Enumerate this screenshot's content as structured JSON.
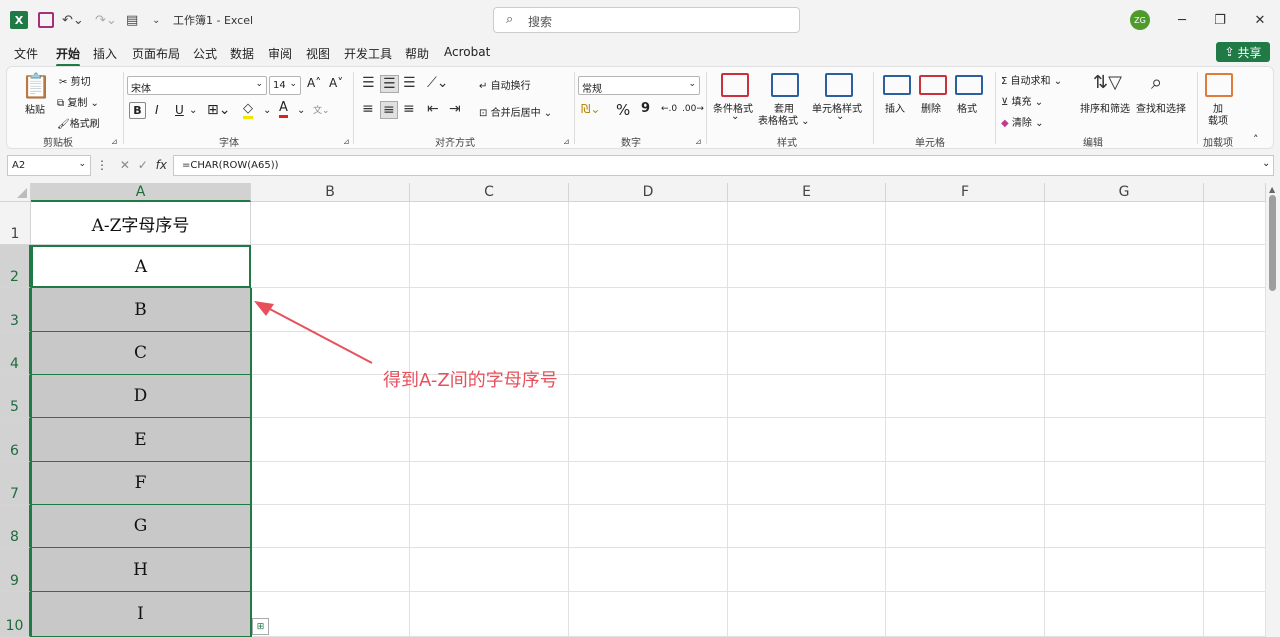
{
  "titlebar": {
    "logo": "X",
    "doc_title": "工作簿1 - Excel",
    "search_placeholder": "搜索",
    "avatar": "ZG",
    "min": "─",
    "restore": "❐",
    "close": "✕"
  },
  "menu": {
    "items": [
      "文件",
      "开始",
      "插入",
      "页面布局",
      "公式",
      "数据",
      "审阅",
      "视图",
      "开发工具",
      "帮助",
      "Acrobat"
    ],
    "active_index": 1,
    "share": "共享"
  },
  "ribbon": {
    "clipboard": {
      "paste": "粘贴",
      "cut": "剪切",
      "copy": "复制",
      "format_painter": "格式刷",
      "label": "剪贴板"
    },
    "font": {
      "font_name": "宋体",
      "font_size": "14",
      "bold": "B",
      "italic": "I",
      "underline": "U",
      "label": "字体"
    },
    "alignment": {
      "wrap": "自动换行",
      "merge": "合并后居中",
      "label": "对齐方式"
    },
    "number": {
      "format": "常规",
      "percent": "%",
      "comma": "9",
      "label": "数字"
    },
    "styles": {
      "conditional": "条件格式",
      "table1": "套用",
      "table2": "表格格式",
      "cell_styles": "单元格样式",
      "label": "样式"
    },
    "cells": {
      "insert": "插入",
      "delete": "删除",
      "format": "格式",
      "label": "单元格"
    },
    "editing": {
      "autosum": "自动求和",
      "fill": "填充",
      "clear": "清除",
      "sort": "排序和筛选",
      "find": "查找和选择",
      "label": "编辑"
    },
    "addins": {
      "line1": "加",
      "line2": "载项",
      "label": "加载项"
    }
  },
  "formula_bar": {
    "name_box": "A2",
    "fx": "fx",
    "formula": "=CHAR(ROW(A65))"
  },
  "sheet": {
    "columns": [
      "A",
      "B",
      "C",
      "D",
      "E",
      "F",
      "G"
    ],
    "rows": [
      "1",
      "2",
      "3",
      "4",
      "5",
      "6",
      "7",
      "8",
      "9",
      "10"
    ],
    "column_a": [
      "A-Z字母序号",
      "A",
      "B",
      "C",
      "D",
      "E",
      "F",
      "G",
      "H",
      "I"
    ]
  },
  "annotation": {
    "text": "得到A-Z间的字母序号",
    "color": "#e8505b"
  },
  "colors": {
    "accent": "#1f7a45",
    "selection_fill": "#c8c8c8"
  }
}
